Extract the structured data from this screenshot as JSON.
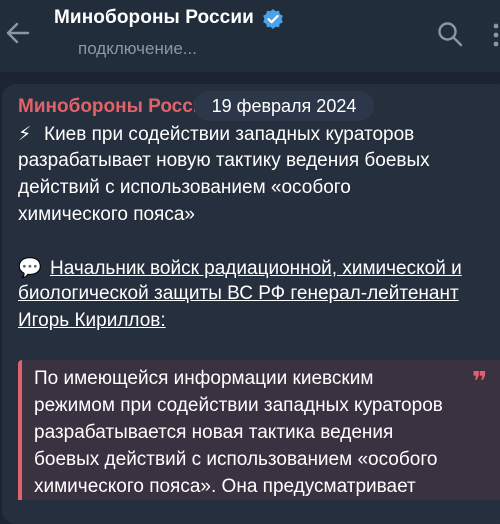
{
  "header": {
    "channel_name": "Минобороны России",
    "status": "подключение..."
  },
  "message": {
    "sender": "Минобороны России",
    "date": "19 февраля 2024",
    "headline_emoji": "⚡",
    "headline_lines": [
      "Киев при содействии западных кураторов",
      "разрабатывает новую тактику ведения боевых",
      "действий с использованием «особого",
      "химического пояса»"
    ],
    "speaker_emoji": "💬",
    "speaker_lines": [
      "Начальник войск радиационной, химической и",
      "биологической защиты ВС РФ генерал-лейтенант",
      "Игорь Кириллов:"
    ],
    "quote_lines": [
      "По имеющейся информации киевским",
      "режимом при содействии западных кураторов",
      "разрабатывается новая тактика ведения",
      "боевых действий с использованием «особого",
      "химического пояса». Она предусматривает"
    ],
    "quote_mark": "❞"
  },
  "colors": {
    "background": "#1c2433",
    "header": "#212d3b",
    "bubble": "#262f3d",
    "sender": "#e0636b",
    "quote_bg": "#3a3240",
    "accent_blue": "#4aa2e8"
  },
  "icons": [
    "back-arrow-icon",
    "verified-badge-icon",
    "search-icon",
    "more-vertical-icon",
    "lightning-icon",
    "speech-bubble-icon"
  ]
}
